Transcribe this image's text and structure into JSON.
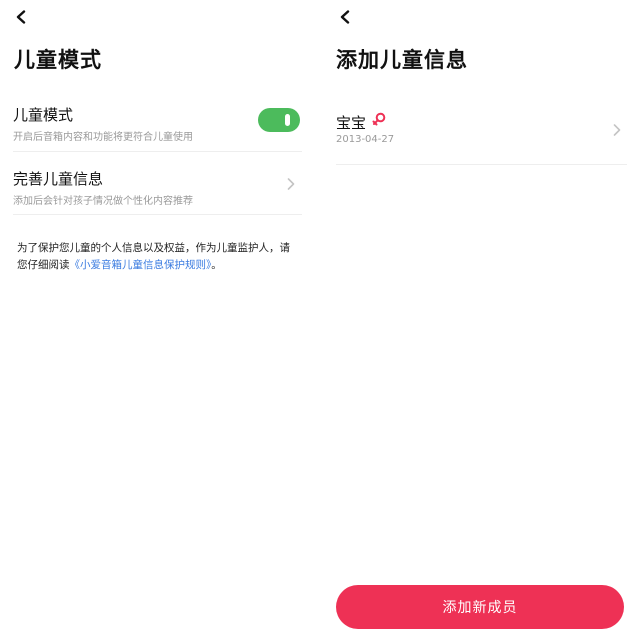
{
  "left_screen": {
    "title": "儿童模式",
    "child_mode_row": {
      "title": "儿童模式",
      "subtitle": "开启后音箱内容和功能将更符合儿童使用",
      "toggle_on": true
    },
    "child_info_row": {
      "title": "完善儿童信息",
      "subtitle": "添加后会针对孩子情况做个性化内容推荐"
    },
    "notice": {
      "text": "为了保护您儿童的个人信息以及权益，作为儿童监护人，请您仔细阅读",
      "link_text": "《小爱音箱儿童信息保护规则》",
      "suffix": "。"
    }
  },
  "right_screen": {
    "title": "添加儿童信息",
    "children": [
      {
        "name": "宝宝",
        "birth_date": "2013-04-27",
        "badge_icon": "female-gender-icon"
      }
    ],
    "add_button_label": "添加新成员"
  },
  "colors": {
    "toggle_on": "#4cbb5c",
    "link": "#3a7be0",
    "primary_button": "#ee3155",
    "badge": "#ee3155",
    "secondary_text": "#9a9a9a"
  },
  "icons": {
    "back": "back-arrow-icon",
    "chevron": "chevron-right-icon"
  }
}
